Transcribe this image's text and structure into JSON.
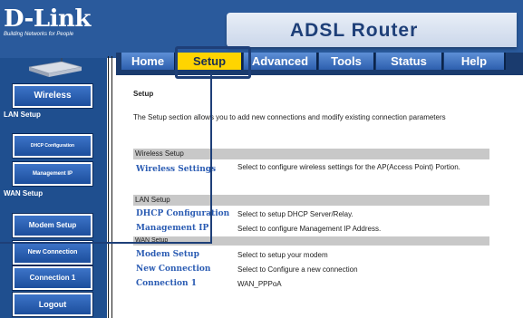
{
  "brand": {
    "logo": "D-Link",
    "tagline": "Building Networks for People",
    "title": "ADSL Router"
  },
  "tabs": [
    {
      "label": "Home"
    },
    {
      "label": "Setup"
    },
    {
      "label": "Advanced"
    },
    {
      "label": "Tools"
    },
    {
      "label": "Status"
    },
    {
      "label": "Help"
    }
  ],
  "sidebar": {
    "wireless": "Wireless",
    "lan_setup": "LAN Setup",
    "dhcp_config": "DHCP Configuration",
    "management_ip": "Management IP",
    "wan_setup": "WAN Setup",
    "modem_setup": "Modem Setup",
    "new_connection": "New Connection",
    "connection1": "Connection 1",
    "logout": "Logout"
  },
  "content": {
    "heading": "Setup",
    "intro": "The Setup section allows you to add new connections and modify existing connection parameters",
    "sections": {
      "wireless": {
        "title": "Wireless Setup",
        "items": [
          {
            "link": "Wireless Settings",
            "desc": "Select to configure wireless settings for the AP(Access Point) Portion."
          }
        ]
      },
      "lan": {
        "title": "LAN Setup",
        "items": [
          {
            "link": "DHCP Configuration",
            "desc": "Select to setup DHCP Server/Relay."
          },
          {
            "link": "Management IP",
            "desc": "Select to configure Management IP Address."
          }
        ]
      },
      "wan": {
        "title": "WAN Setup",
        "items": [
          {
            "link": "Modem Setup",
            "desc": "Select to setup your modem"
          },
          {
            "link": "New Connection",
            "desc": "Select to Configure a new connection"
          },
          {
            "link": "Connection 1",
            "desc": "WAN_PPPoA"
          }
        ]
      }
    }
  },
  "colors": {
    "header": "#2a5a9c",
    "sidebar": "#1f4f8f",
    "active_tab": "#ffd400",
    "link": "#2b5cb3"
  }
}
